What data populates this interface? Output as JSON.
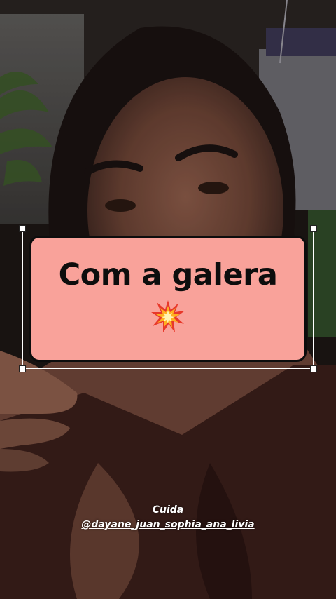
{
  "story": {
    "sticker": {
      "text": "Com a galera",
      "emoji": "collision-emoji",
      "background": "#f9a29a",
      "border_color": "#0d0d0d"
    },
    "caption": {
      "title": "Cuida",
      "mention": "@dayane_juan_sophia_ana_livia"
    }
  }
}
